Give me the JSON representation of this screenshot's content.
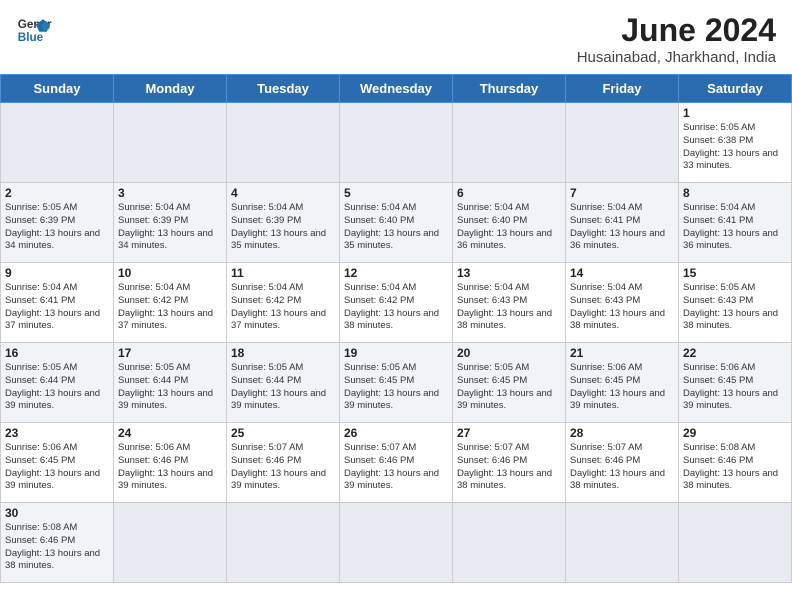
{
  "header": {
    "logo_line1": "General",
    "logo_line2": "Blue",
    "main_title": "June 2024",
    "subtitle": "Husainabad, Jharkhand, India"
  },
  "weekdays": [
    "Sunday",
    "Monday",
    "Tuesday",
    "Wednesday",
    "Thursday",
    "Friday",
    "Saturday"
  ],
  "weeks": [
    [
      {
        "day": "",
        "empty": true
      },
      {
        "day": "",
        "empty": true
      },
      {
        "day": "",
        "empty": true
      },
      {
        "day": "",
        "empty": true
      },
      {
        "day": "",
        "empty": true
      },
      {
        "day": "",
        "empty": true
      },
      {
        "day": "1",
        "sunrise": "5:05 AM",
        "sunset": "6:38 PM",
        "daylight": "13 hours and 33 minutes."
      }
    ],
    [
      {
        "day": "2",
        "sunrise": "5:05 AM",
        "sunset": "6:39 PM",
        "daylight": "13 hours and 34 minutes."
      },
      {
        "day": "3",
        "sunrise": "5:04 AM",
        "sunset": "6:39 PM",
        "daylight": "13 hours and 34 minutes."
      },
      {
        "day": "4",
        "sunrise": "5:04 AM",
        "sunset": "6:39 PM",
        "daylight": "13 hours and 35 minutes."
      },
      {
        "day": "5",
        "sunrise": "5:04 AM",
        "sunset": "6:40 PM",
        "daylight": "13 hours and 35 minutes."
      },
      {
        "day": "6",
        "sunrise": "5:04 AM",
        "sunset": "6:40 PM",
        "daylight": "13 hours and 36 minutes."
      },
      {
        "day": "7",
        "sunrise": "5:04 AM",
        "sunset": "6:41 PM",
        "daylight": "13 hours and 36 minutes."
      },
      {
        "day": "8",
        "sunrise": "5:04 AM",
        "sunset": "6:41 PM",
        "daylight": "13 hours and 36 minutes."
      }
    ],
    [
      {
        "day": "9",
        "sunrise": "5:04 AM",
        "sunset": "6:41 PM",
        "daylight": "13 hours and 37 minutes."
      },
      {
        "day": "10",
        "sunrise": "5:04 AM",
        "sunset": "6:42 PM",
        "daylight": "13 hours and 37 minutes."
      },
      {
        "day": "11",
        "sunrise": "5:04 AM",
        "sunset": "6:42 PM",
        "daylight": "13 hours and 37 minutes."
      },
      {
        "day": "12",
        "sunrise": "5:04 AM",
        "sunset": "6:42 PM",
        "daylight": "13 hours and 38 minutes."
      },
      {
        "day": "13",
        "sunrise": "5:04 AM",
        "sunset": "6:43 PM",
        "daylight": "13 hours and 38 minutes."
      },
      {
        "day": "14",
        "sunrise": "5:04 AM",
        "sunset": "6:43 PM",
        "daylight": "13 hours and 38 minutes."
      },
      {
        "day": "15",
        "sunrise": "5:05 AM",
        "sunset": "6:43 PM",
        "daylight": "13 hours and 38 minutes."
      }
    ],
    [
      {
        "day": "16",
        "sunrise": "5:05 AM",
        "sunset": "6:44 PM",
        "daylight": "13 hours and 39 minutes."
      },
      {
        "day": "17",
        "sunrise": "5:05 AM",
        "sunset": "6:44 PM",
        "daylight": "13 hours and 39 minutes."
      },
      {
        "day": "18",
        "sunrise": "5:05 AM",
        "sunset": "6:44 PM",
        "daylight": "13 hours and 39 minutes."
      },
      {
        "day": "19",
        "sunrise": "5:05 AM",
        "sunset": "6:45 PM",
        "daylight": "13 hours and 39 minutes."
      },
      {
        "day": "20",
        "sunrise": "5:05 AM",
        "sunset": "6:45 PM",
        "daylight": "13 hours and 39 minutes."
      },
      {
        "day": "21",
        "sunrise": "5:06 AM",
        "sunset": "6:45 PM",
        "daylight": "13 hours and 39 minutes."
      },
      {
        "day": "22",
        "sunrise": "5:06 AM",
        "sunset": "6:45 PM",
        "daylight": "13 hours and 39 minutes."
      }
    ],
    [
      {
        "day": "23",
        "sunrise": "5:06 AM",
        "sunset": "6:45 PM",
        "daylight": "13 hours and 39 minutes."
      },
      {
        "day": "24",
        "sunrise": "5:06 AM",
        "sunset": "6:46 PM",
        "daylight": "13 hours and 39 minutes."
      },
      {
        "day": "25",
        "sunrise": "5:07 AM",
        "sunset": "6:46 PM",
        "daylight": "13 hours and 39 minutes."
      },
      {
        "day": "26",
        "sunrise": "5:07 AM",
        "sunset": "6:46 PM",
        "daylight": "13 hours and 39 minutes."
      },
      {
        "day": "27",
        "sunrise": "5:07 AM",
        "sunset": "6:46 PM",
        "daylight": "13 hours and 38 minutes."
      },
      {
        "day": "28",
        "sunrise": "5:07 AM",
        "sunset": "6:46 PM",
        "daylight": "13 hours and 38 minutes."
      },
      {
        "day": "29",
        "sunrise": "5:08 AM",
        "sunset": "6:46 PM",
        "daylight": "13 hours and 38 minutes."
      }
    ],
    [
      {
        "day": "30",
        "sunrise": "5:08 AM",
        "sunset": "6:46 PM",
        "daylight": "13 hours and 38 minutes."
      },
      {
        "day": "",
        "empty": true
      },
      {
        "day": "",
        "empty": true
      },
      {
        "day": "",
        "empty": true
      },
      {
        "day": "",
        "empty": true
      },
      {
        "day": "",
        "empty": true
      },
      {
        "day": "",
        "empty": true
      }
    ]
  ],
  "labels": {
    "sunrise_prefix": "Sunrise: ",
    "sunset_prefix": "Sunset: ",
    "daylight_prefix": "Daylight: "
  }
}
